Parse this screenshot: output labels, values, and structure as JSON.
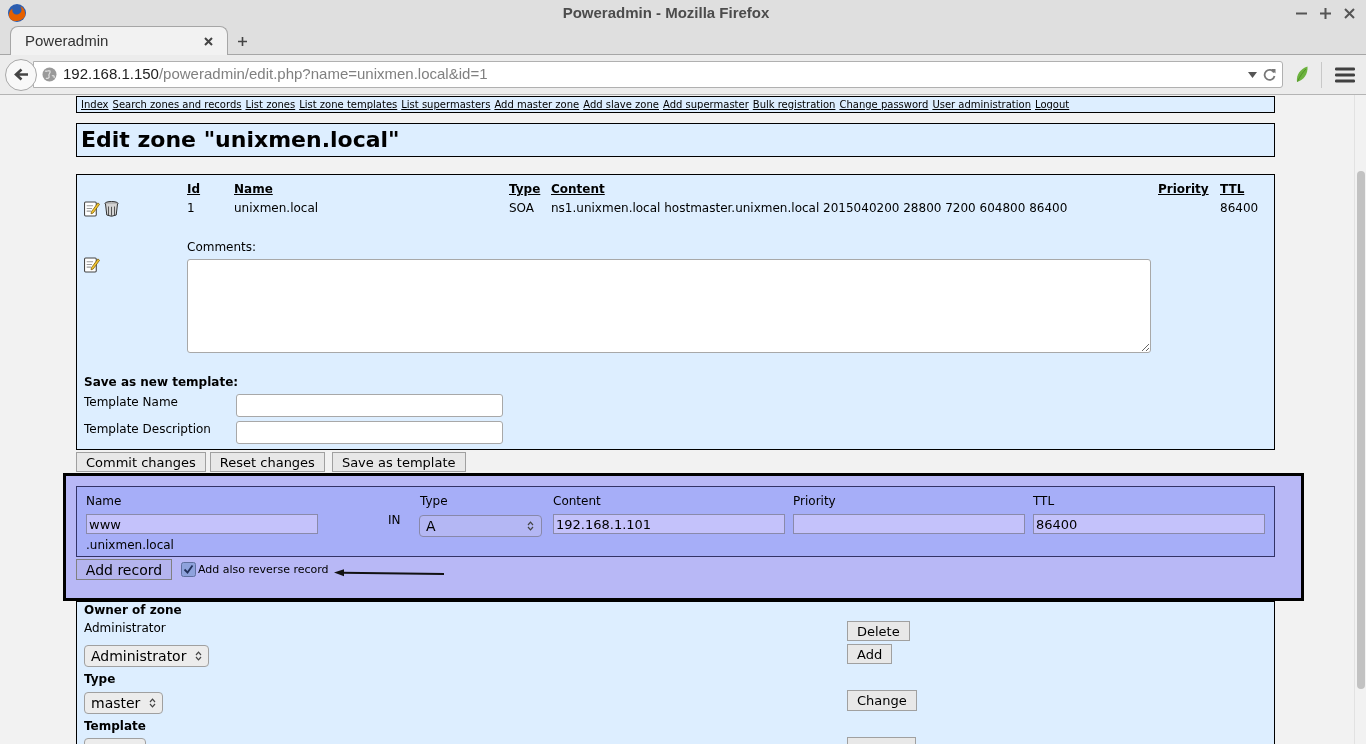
{
  "window": {
    "title": "Poweradmin - Mozilla Firefox"
  },
  "tabs": [
    {
      "label": "Poweradmin",
      "selected": true
    }
  ],
  "address_bar": {
    "host": "192.168.1.150",
    "path": "/poweradmin/edit.php?name=unixmen.local&id=1"
  },
  "nav_links": [
    "Index",
    "Search zones and records",
    "List zones",
    "List zone templates",
    "List supermasters",
    "Add master zone",
    "Add slave zone",
    "Add supermaster",
    "Bulk registration",
    "Change password",
    "User administration",
    "Logout"
  ],
  "page_title": "Edit zone \"unixmen.local\"",
  "records": {
    "columns": [
      "Id",
      "Name",
      "Type",
      "Content",
      "Priority",
      "TTL"
    ],
    "rows": [
      {
        "id": "1",
        "name": "unixmen.local",
        "type": "SOA",
        "content": "ns1.unixmen.local hostmaster.unixmen.local 2015040200 28800 7200 604800 86400",
        "ttl": "86400"
      }
    ],
    "comments_label": "Comments:"
  },
  "save_template": {
    "heading": "Save as new template:",
    "fields": [
      {
        "label": "Template Name"
      },
      {
        "label": "Template Description"
      }
    ]
  },
  "form_buttons": [
    "Commit changes",
    "Reset changes",
    "Save as template"
  ],
  "add_record": {
    "name": {
      "label": "Name",
      "value": "www",
      "suffix": ".unixmen.local"
    },
    "class": "IN",
    "type": {
      "label": "Type",
      "value": "A"
    },
    "content": {
      "label": "Content",
      "value": "192.168.1.101"
    },
    "priority": {
      "label": "Priority"
    },
    "ttl": {
      "label": "TTL",
      "value": "86400"
    },
    "button": "Add record",
    "reverse": {
      "label": "Add also reverse record",
      "checked": true
    }
  },
  "owner": {
    "heading": "Owner of zone",
    "current": "Administrator",
    "select_value": "Administrator",
    "buttons": [
      "Delete",
      "Add"
    ]
  },
  "zone_type": {
    "heading": "Type",
    "select_value": "master",
    "button": "Change"
  },
  "template": {
    "heading": "Template"
  }
}
